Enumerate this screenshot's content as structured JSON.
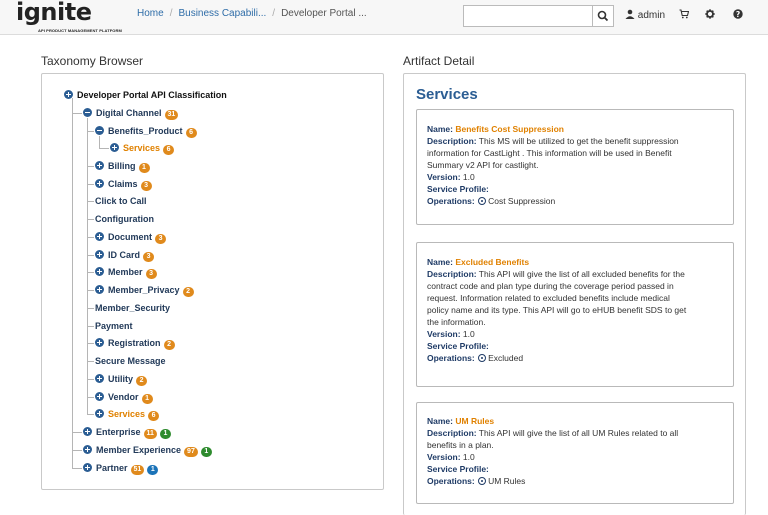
{
  "header": {
    "logo_text": "ignite",
    "logo_tagline": "API PRODUCT MANAGEMENT PLATFORM",
    "breadcrumb": [
      "Home",
      "Business Capabili...",
      "Developer Portal ..."
    ],
    "search_placeholder": "",
    "search_icon": "search-icon",
    "user_label": "admin",
    "user_icon": "user-icon",
    "cart_icon": "cart-icon",
    "settings_icon": "gear-icon",
    "help_icon": "help-icon"
  },
  "taxonomy": {
    "title": "Taxonomy Browser",
    "nodes": [
      {
        "label": "Developer Portal API Classification",
        "icon": "plus",
        "badges": []
      },
      {
        "label": "Digital Channel",
        "icon": "minus",
        "badges": [
          {
            "text": "31",
            "color": "orange"
          }
        ]
      },
      {
        "label": "Benefits_Product",
        "icon": "minus",
        "badges": [
          {
            "text": "6",
            "color": "orange"
          }
        ]
      },
      {
        "label": "Services",
        "icon": "plus",
        "badges": [
          {
            "text": "6",
            "color": "orange"
          }
        ]
      },
      {
        "label": "Billing",
        "icon": "plus",
        "badges": [
          {
            "text": "1",
            "color": "orange"
          }
        ]
      },
      {
        "label": "Claims",
        "icon": "plus",
        "badges": [
          {
            "text": "3",
            "color": "orange"
          }
        ]
      },
      {
        "label": "Click to Call",
        "icon": "",
        "badges": []
      },
      {
        "label": "Configuration",
        "icon": "",
        "badges": []
      },
      {
        "label": "Document",
        "icon": "plus",
        "badges": [
          {
            "text": "3",
            "color": "orange"
          }
        ]
      },
      {
        "label": "ID Card",
        "icon": "plus",
        "badges": [
          {
            "text": "3",
            "color": "orange"
          }
        ]
      },
      {
        "label": "Member",
        "icon": "plus",
        "badges": [
          {
            "text": "3",
            "color": "orange"
          }
        ]
      },
      {
        "label": "Member_Privacy",
        "icon": "plus",
        "badges": [
          {
            "text": "2",
            "color": "orange"
          }
        ]
      },
      {
        "label": "Member_Security",
        "icon": "",
        "badges": []
      },
      {
        "label": "Payment",
        "icon": "",
        "badges": []
      },
      {
        "label": "Registration",
        "icon": "plus",
        "badges": [
          {
            "text": "2",
            "color": "orange"
          }
        ]
      },
      {
        "label": "Secure Message",
        "icon": "",
        "badges": []
      },
      {
        "label": "Utility",
        "icon": "plus",
        "badges": [
          {
            "text": "2",
            "color": "orange"
          }
        ]
      },
      {
        "label": "Vendor",
        "icon": "plus",
        "badges": [
          {
            "text": "1",
            "color": "orange"
          }
        ]
      },
      {
        "label": "Services",
        "icon": "plus",
        "badges": [
          {
            "text": "6",
            "color": "orange"
          }
        ]
      },
      {
        "label": "Enterprise",
        "icon": "plus",
        "badges": [
          {
            "text": "11",
            "color": "orange"
          },
          {
            "text": "1",
            "color": "green"
          }
        ]
      },
      {
        "label": "Member Experience",
        "icon": "plus",
        "badges": [
          {
            "text": "97",
            "color": "orange"
          },
          {
            "text": "1",
            "color": "green"
          }
        ]
      },
      {
        "label": "Partner",
        "icon": "plus",
        "badges": [
          {
            "text": "51",
            "color": "orange"
          },
          {
            "text": "1",
            "color": "blue"
          }
        ]
      }
    ]
  },
  "artifact": {
    "panel_title": "Artifact Detail",
    "heading": "Services",
    "labels": {
      "name": "Name:",
      "description": "Description:",
      "version": "Version:",
      "service_profile": "Service Profile:",
      "operations": "Operations:"
    },
    "cards": [
      {
        "name": "Benefits Cost Suppression",
        "description_lines": [
          " This MS will be utilized to get the benefit suppression",
          "information for CastLight . This information will be used in Benefit",
          "Summary v2 API for castlight."
        ],
        "version": " 1.0",
        "operation": "Cost Suppression"
      },
      {
        "name": "Excluded Benefits",
        "description_lines": [
          " This API will give the list of all excluded benefits for the",
          "contract code and plan type during the coverage period passed in",
          "request. Information related to excluded benefits include medical",
          "policy name and its type. This API will go to eHUB benefit SDS to get",
          "the information."
        ],
        "version": " 1.0",
        "operation": "Excluded"
      },
      {
        "name": "UM Rules",
        "description_lines": [
          " This API will give the list of all UM Rules related to all",
          "benefits in a plan."
        ],
        "version": " 1.0",
        "operation": "UM Rules"
      }
    ]
  },
  "colors": {
    "accent_blue": "#2b5d93",
    "badge_orange": "#e08a1c",
    "badge_green": "#2e8b2e",
    "badge_blue": "#1b73b8",
    "name_orange": "#e08100"
  }
}
